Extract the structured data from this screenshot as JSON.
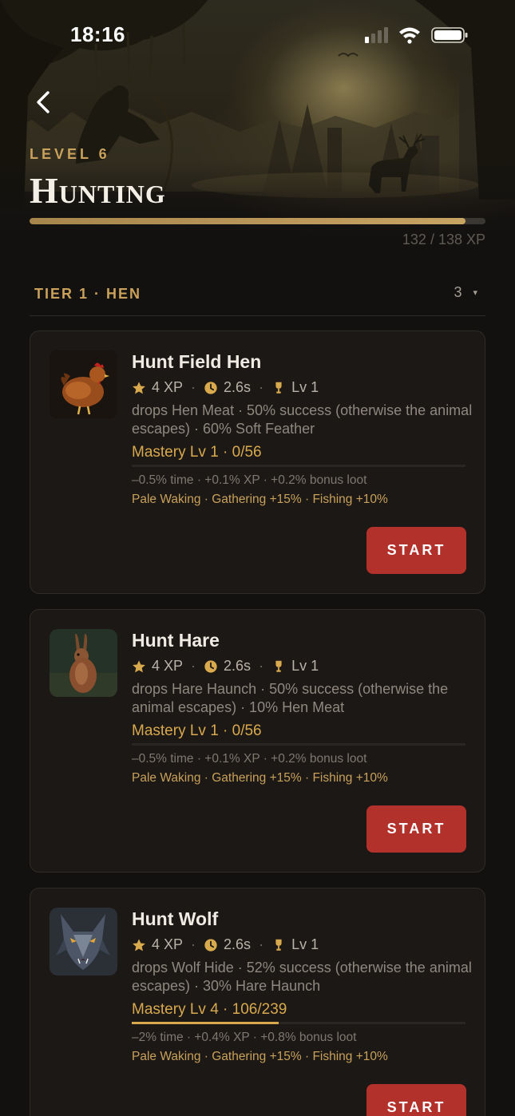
{
  "status_bar": {
    "time": "18:16"
  },
  "header": {
    "level_label": "LEVEL 6",
    "title": "Hunting",
    "xp_text": "132 / 138 XP",
    "xp_current": 132,
    "xp_max": 138
  },
  "tier": {
    "label": "TIER 1 · HEN",
    "count": "3",
    "caret": "▾"
  },
  "cards": [
    {
      "title": "Hunt Field Hen",
      "xp": "4 XP",
      "time": "2.6s",
      "level": "Lv 1",
      "description": "drops Hen Meat · 50% success (otherwise the animal escapes) · 60% Soft Feather",
      "mastery": "Mastery Lv 1 · 0/56",
      "mastery_progress": 0.0,
      "bonus": "–0.5% time · +0.1% XP · +0.2% bonus loot",
      "perks": "Pale Waking · Gathering +15% · Fishing +10%",
      "button": "START",
      "thumb_icon": "hen-icon"
    },
    {
      "title": "Hunt Hare",
      "xp": "4 XP",
      "time": "2.6s",
      "level": "Lv 1",
      "description": "drops Hare Haunch · 50% success (otherwise the animal escapes) · 10% Hen Meat",
      "mastery": "Mastery Lv 1 · 0/56",
      "mastery_progress": 0.0,
      "bonus": "–0.5% time · +0.1% XP · +0.2% bonus loot",
      "perks": "Pale Waking · Gathering +15% · Fishing +10%",
      "button": "START",
      "thumb_icon": "hare-icon"
    },
    {
      "title": "Hunt Wolf",
      "xp": "4 XP",
      "time": "2.6s",
      "level": "Lv 1",
      "description": "drops Wolf Hide · 52% success (otherwise the animal escapes) · 30% Hare Haunch",
      "mastery": "Mastery Lv 4 · 106/239",
      "mastery_progress": 0.44,
      "bonus": "–2% time · +0.4% XP · +0.8% bonus loot",
      "perks": "Pale Waking · Gathering +15% · Fishing +10%",
      "button": "START",
      "thumb_icon": "wolf-icon"
    }
  ],
  "colors": {
    "accent_gold": "#c9a15a",
    "mastery_gold": "#d9a94d",
    "start_red": "#b3312b",
    "background": "#131110",
    "card": "#1b1816"
  }
}
